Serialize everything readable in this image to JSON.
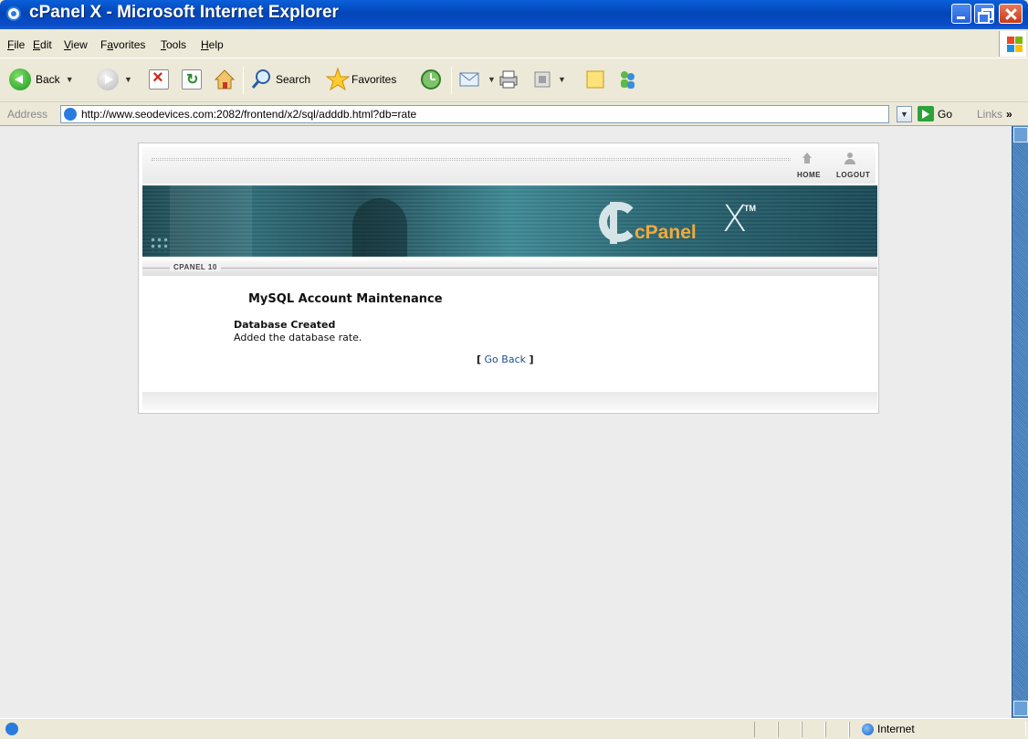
{
  "window": {
    "title": "cPanel X - Microsoft Internet Explorer"
  },
  "menu": {
    "items": [
      {
        "label": "File",
        "mnemonic": "F",
        "rest": "ile"
      },
      {
        "label": "Edit",
        "mnemonic": "E",
        "rest": "dit"
      },
      {
        "label": "View",
        "mnemonic": "V",
        "rest": "iew"
      },
      {
        "label": "Favorites",
        "pre": "F",
        "mnemonic": "a",
        "rest": "vorites"
      },
      {
        "label": "Tools",
        "mnemonic": "T",
        "rest": "ools"
      },
      {
        "label": "Help",
        "mnemonic": "H",
        "rest": "elp"
      }
    ]
  },
  "toolbar": {
    "back_label": "Back",
    "search_label": "Search",
    "favorites_label": "Favorites"
  },
  "address": {
    "label": "Address",
    "url": "http://www.seodevices.com:2082/frontend/x2/sql/adddb.html?db=rate",
    "go_label": "Go",
    "links_label": "Links",
    "links_chevron": "»"
  },
  "cpanel": {
    "home_label": "HOME",
    "logout_label": "LOGOUT",
    "logo_word": "cPanel",
    "logo_x": "X",
    "logo_tm": "TM",
    "version_label": "CPANEL 10",
    "page_title": "MySQL Account Maintenance",
    "status_heading": "Database Created",
    "status_message": "Added the database rate.",
    "go_back_open": "[",
    "go_back_label": "Go Back",
    "go_back_close": "]"
  },
  "statusbar": {
    "zone_label": "Internet"
  },
  "colors": {
    "titlebar": "#0346b8",
    "chrome": "#ece9d8",
    "page_bg": "#ececec",
    "banner": "#2f6c78",
    "logo_accent": "#f3a93a",
    "link": "#1f4e8c"
  },
  "icons": [
    "ie-icon",
    "back-arrow-icon",
    "forward-arrow-icon",
    "stop-icon",
    "refresh-icon",
    "home-icon",
    "search-icon",
    "favorites-star-icon",
    "history-icon",
    "mail-icon",
    "print-icon",
    "edit-icon",
    "discuss-icon",
    "messenger-icon",
    "page-icon",
    "go-arrow-icon",
    "globe-icon",
    "cpanel-home-icon",
    "cpanel-logout-icon",
    "windows-logo-icon"
  ]
}
